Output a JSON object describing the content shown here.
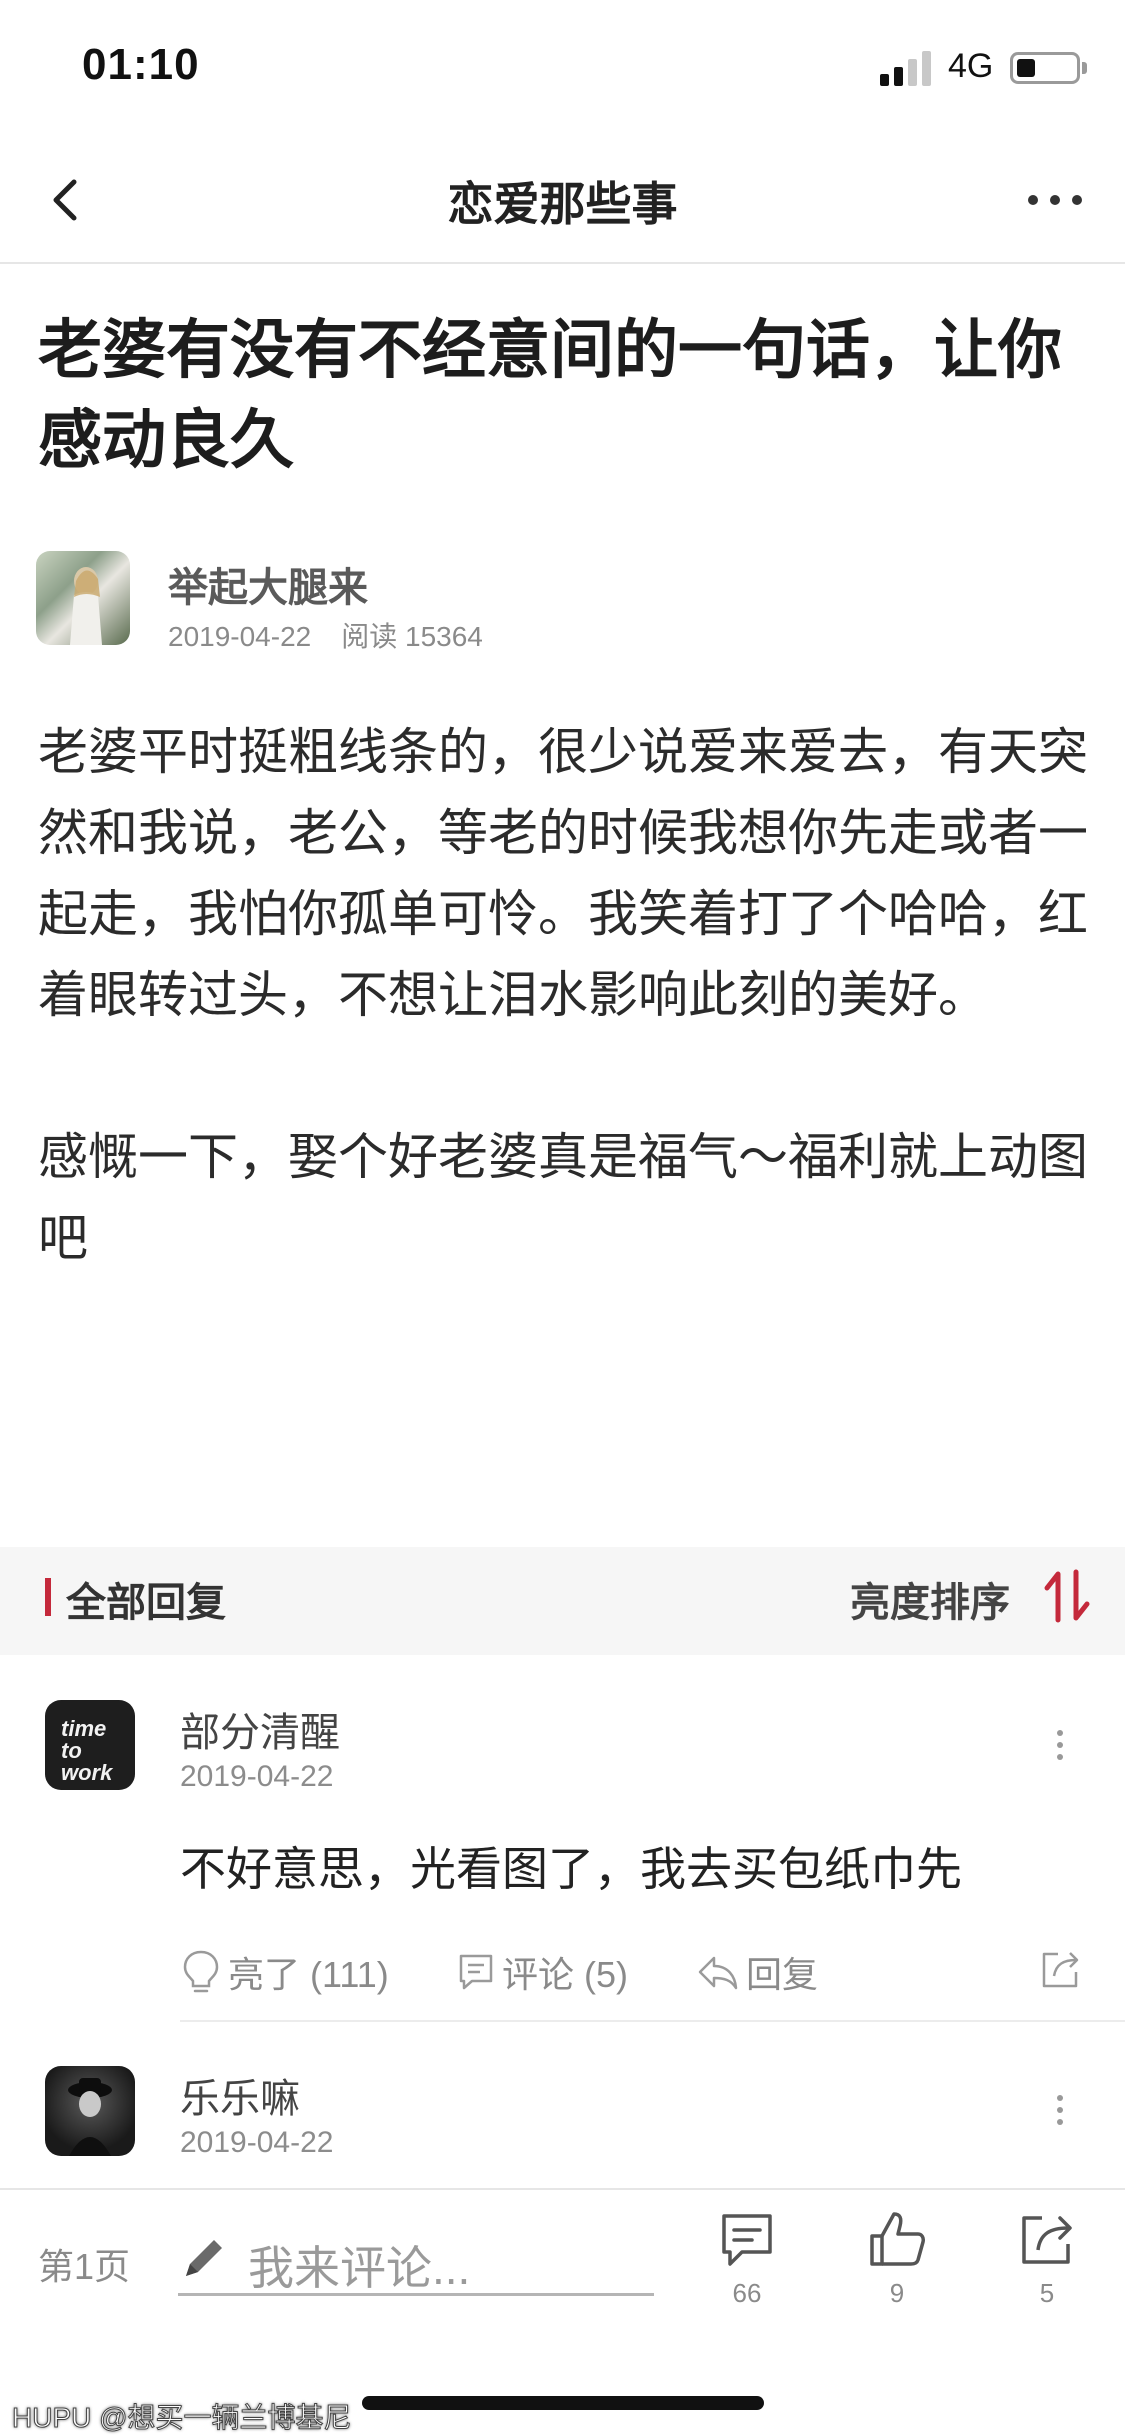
{
  "status_bar": {
    "time": "01:10",
    "network": "4G"
  },
  "nav": {
    "title": "恋爱那些事"
  },
  "post": {
    "title": "老婆有没有不经意间的一句话，让你感动良久",
    "author": "举起大腿来",
    "date": "2019-04-22",
    "views": "阅读 15364",
    "body": "老婆平时挺粗线条的，很少说爱来爱去，有天突然和我说，老公，等老的时候我想你先走或者一起走，我怕你孤单可怜。我笑着打了个哈哈，红着眼转过头，不想让泪水影响此刻的美好。\n\n感慨一下，娶个好老婆真是福气～福利就上动图吧"
  },
  "replies": {
    "label": "全部回复",
    "sort_label": "亮度排序"
  },
  "comments": [
    {
      "name": "部分清醒",
      "date": "2019-04-22",
      "text": "不好意思，光看图了，我去买包纸巾先",
      "avatar_text": "time to work",
      "actions": {
        "like": "亮了 (111)",
        "comment": "评论 (5)",
        "reply": "回复"
      }
    },
    {
      "name": "乐乐嘛",
      "date": "2019-04-22"
    }
  ],
  "bottom_bar": {
    "page": "第1页",
    "comment_placeholder": "我来评论...",
    "comments_count": "66",
    "likes_count": "9",
    "shares_count": "5"
  },
  "watermark": "HUPU @想买一辆兰博基尼",
  "colors": {
    "accent": "#c4293b",
    "text": "#222222",
    "meta": "#8a8a8a",
    "section_bg": "#f6f6f6"
  }
}
